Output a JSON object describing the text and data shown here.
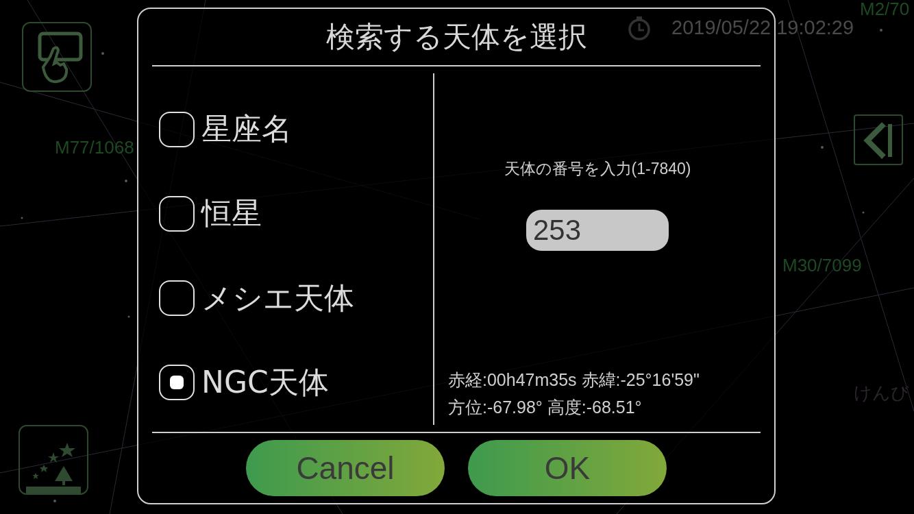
{
  "status": {
    "time": "2019/05/22 19:02:29"
  },
  "sky_labels": [
    {
      "text": "M2/70",
      "kind": "object"
    },
    {
      "text": "M77/1068",
      "kind": "object"
    },
    {
      "text": "M30/7099",
      "kind": "object"
    },
    {
      "text": "けんび",
      "kind": "constellation"
    }
  ],
  "dialog": {
    "title": "検索する天体を選択",
    "options": [
      {
        "label": "星座名",
        "selected": false
      },
      {
        "label": "恒星",
        "selected": false
      },
      {
        "label": "メシエ天体",
        "selected": false
      },
      {
        "label": "NGC天体",
        "selected": true
      }
    ],
    "prompt": "天体の番号を入力(1-7840)",
    "number": {
      "value": "253"
    },
    "coordinates": [
      "赤経:00h47m35s 赤緯:-25°16'59\"",
      "方位:-67.98° 高度:-68.51°"
    ],
    "buttons": [
      "Cancel",
      "OK"
    ]
  }
}
